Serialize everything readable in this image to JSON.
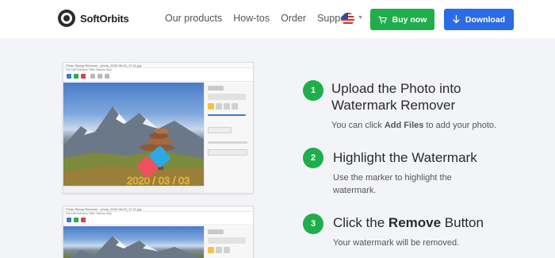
{
  "header": {
    "logo_text": "SoftOrbits",
    "nav": [
      "Our products",
      "How-tos",
      "Order",
      "Support"
    ],
    "language_flag": "us-flag-icon",
    "buy_label": "Buy now",
    "download_label": "Download",
    "colors": {
      "buy": "#1fae4b",
      "download": "#2c6be6"
    }
  },
  "screenshots": {
    "window_title": "Photo Stamp Remover - photo_2020-08-03_17-11.jpg",
    "menu": "File  Edit  Selection  Filter  Options  Help",
    "watermark_text": "2020 / 03 / 03"
  },
  "steps": [
    {
      "number": "1",
      "title": "Upload the Photo into Watermark Remover",
      "desc_before": "You can click ",
      "desc_bold": "Add Files",
      "desc_after": " to add your photo."
    },
    {
      "number": "2",
      "title": "Highlight the Watermark",
      "desc": "Use the marker to highlight the watermark."
    },
    {
      "number": "3",
      "title_before": "Click the ",
      "title_bold": "Remove",
      "title_after": " Button",
      "desc": "Your watermark will be removed."
    }
  ]
}
